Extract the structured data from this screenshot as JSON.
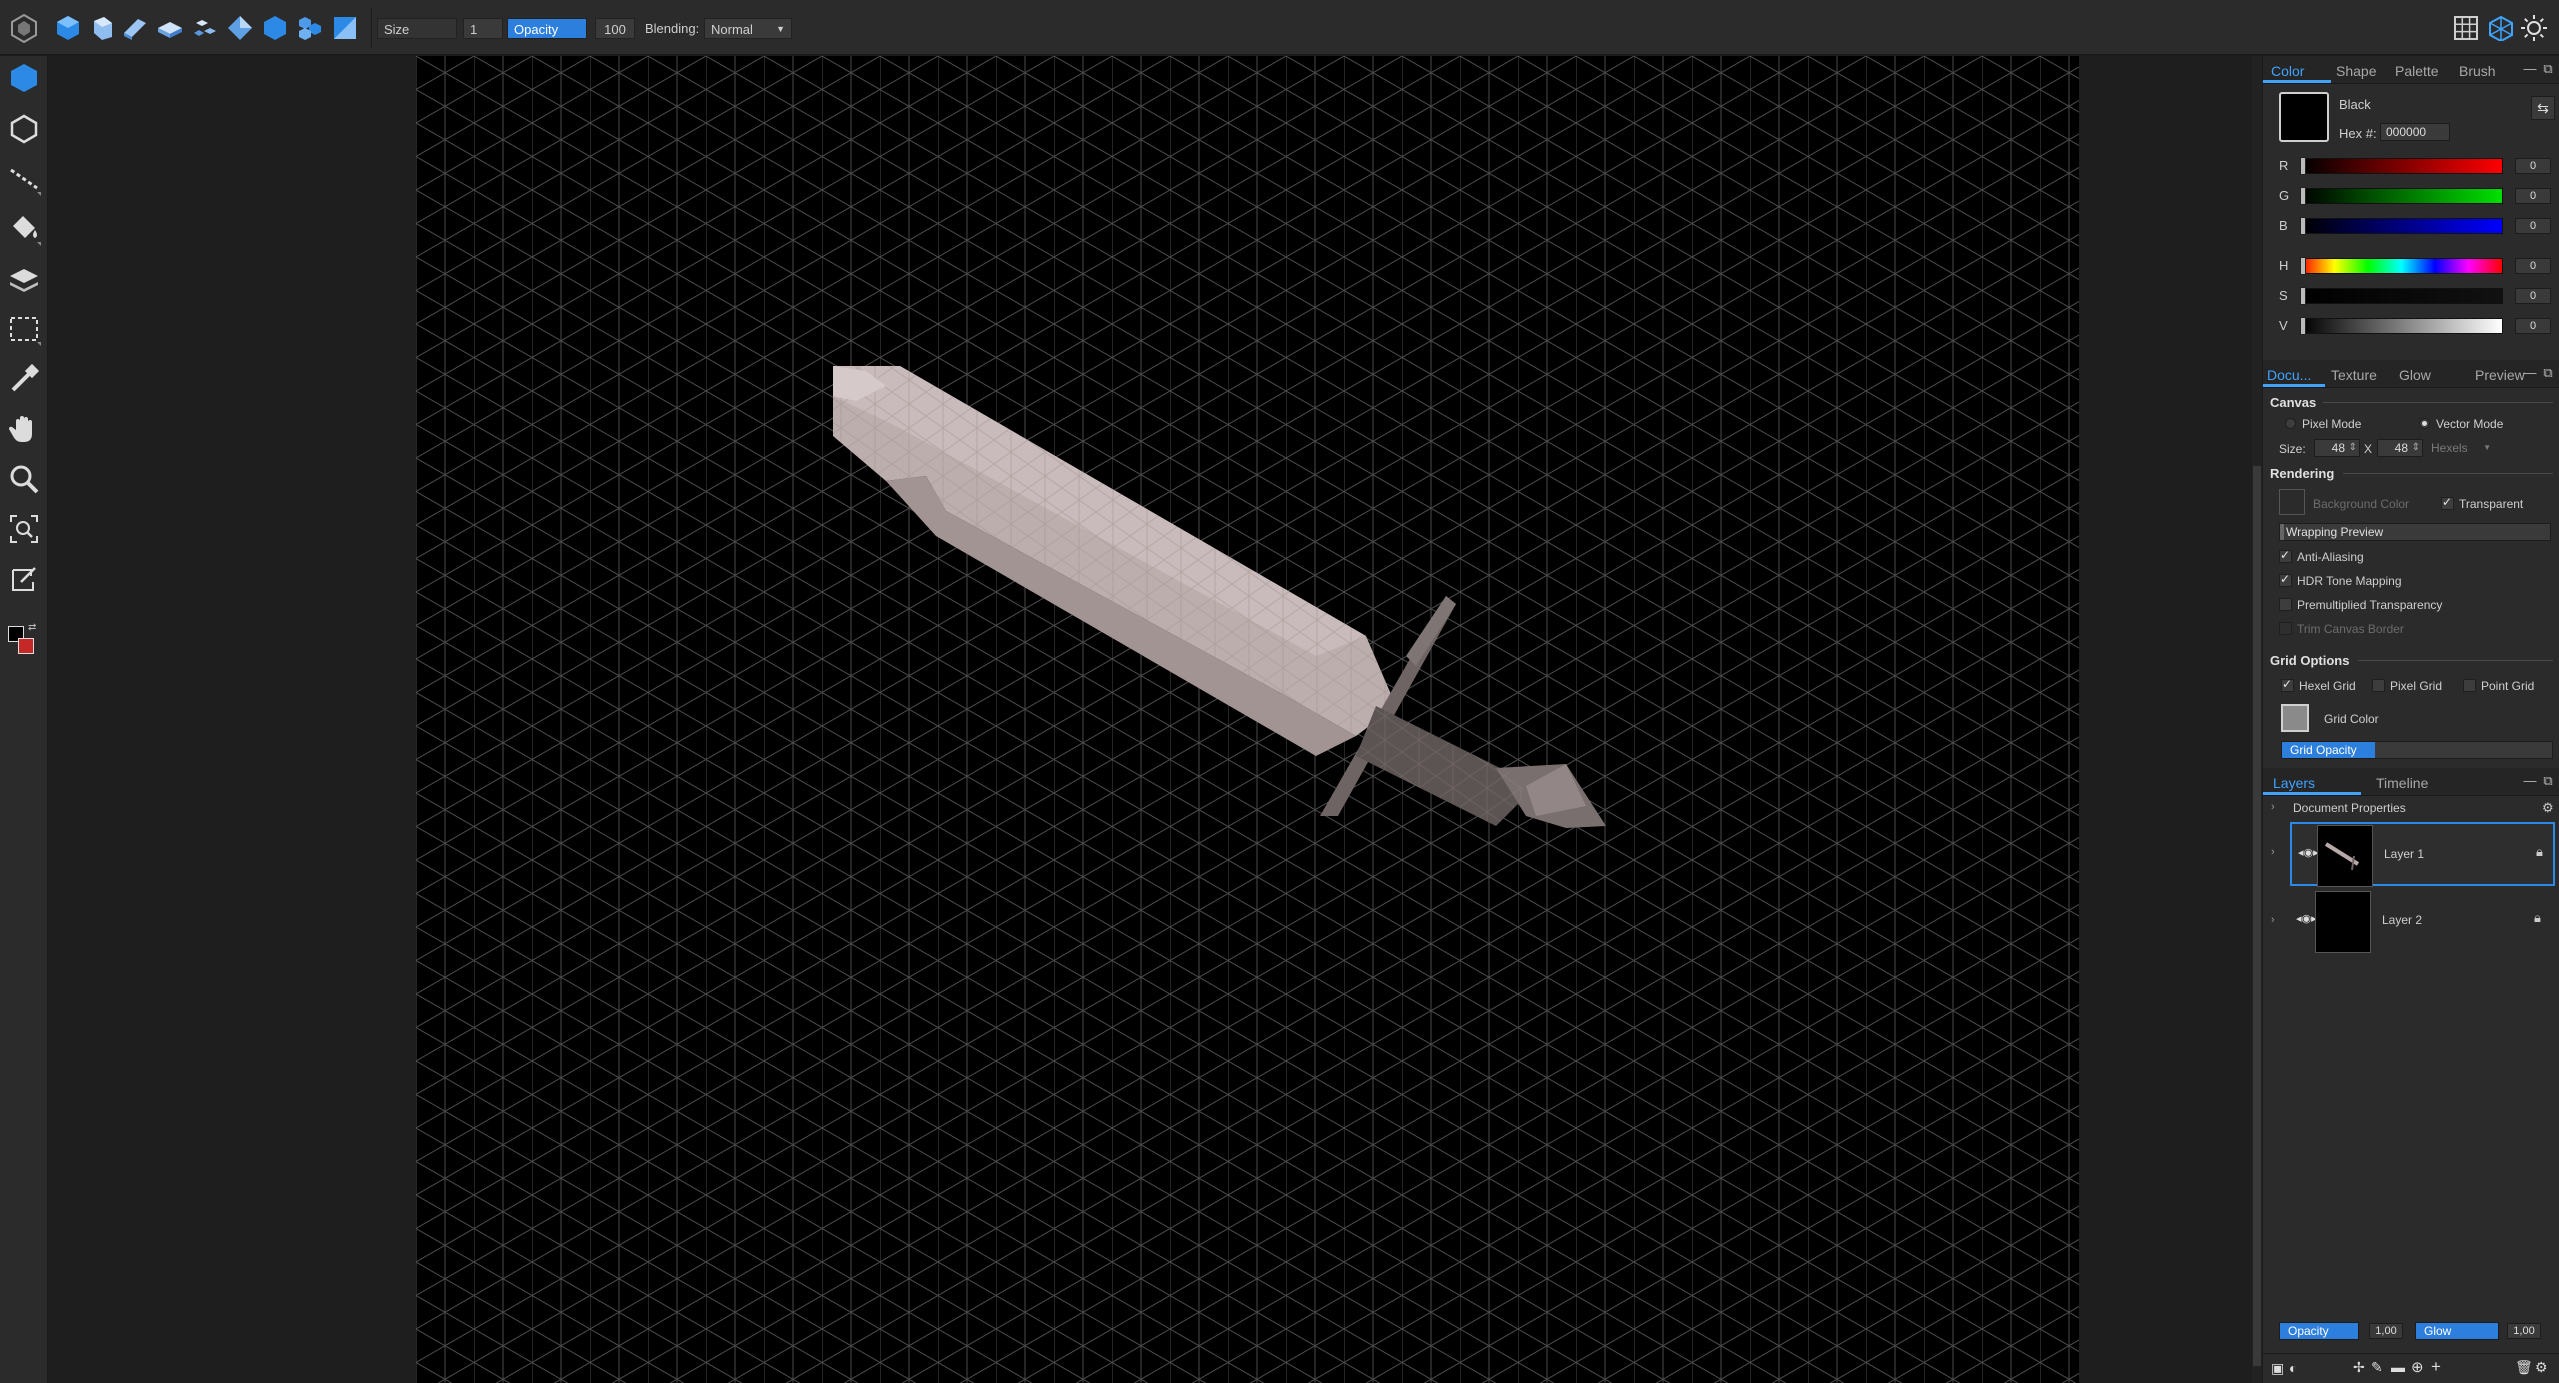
{
  "toolbar": {
    "size_label": "Size",
    "size_value": "1",
    "opacity_label": "Opacity",
    "opacity_value": "100",
    "blending_label": "Blending:",
    "blending_value": "Normal"
  },
  "color_panel": {
    "tabs": [
      "Color",
      "Shape",
      "Palette",
      "Brush"
    ],
    "active_tab": "Color",
    "color_name": "Black",
    "hex_label": "Hex #:",
    "hex_value": "000000",
    "channels": [
      {
        "label": "R",
        "value": "0"
      },
      {
        "label": "G",
        "value": "0"
      },
      {
        "label": "B",
        "value": "0"
      },
      {
        "label": "H",
        "value": "0"
      },
      {
        "label": "S",
        "value": "0"
      },
      {
        "label": "V",
        "value": "0"
      }
    ]
  },
  "document_panel": {
    "tabs": [
      "Docu...",
      "Texture",
      "Glow",
      "Preview"
    ],
    "active_tab": "Docu...",
    "canvas_title": "Canvas",
    "pixel_mode": "Pixel Mode",
    "vector_mode": "Vector Mode",
    "size_label": "Size:",
    "size_w": "48",
    "size_x": "X",
    "size_h": "48",
    "size_unit": "Hexels",
    "rendering_title": "Rendering",
    "background_color": "Background Color",
    "transparent": "Transparent",
    "wrapping_preview": "Wrapping Preview",
    "anti_aliasing": "Anti-Aliasing",
    "hdr_tone_mapping": "HDR Tone Mapping",
    "premultiplied_transparency": "Premultiplied Transparency",
    "trim_canvas_border": "Trim Canvas Border",
    "grid_options_title": "Grid Options",
    "hexel_grid": "Hexel Grid",
    "pixel_grid": "Pixel Grid",
    "point_grid": "Point Grid",
    "grid_color": "Grid Color",
    "grid_opacity": "Grid Opacity"
  },
  "layers_panel": {
    "tabs": [
      "Layers",
      "Timeline"
    ],
    "active_tab": "Layers",
    "document_properties": "Document Properties",
    "layers": [
      {
        "name": "Layer 1",
        "selected": true
      },
      {
        "name": "Layer 2",
        "selected": false
      }
    ],
    "opacity_label": "Opacity",
    "opacity_value": "1,00",
    "glow_label": "Glow",
    "glow_value": "1,00"
  },
  "colors": {
    "accent": "#2c7fdc",
    "panel_bg": "#2b2b2b",
    "canvas_bg": "#000000",
    "blade": "#b9a9a9",
    "guard": "#6e6464"
  }
}
